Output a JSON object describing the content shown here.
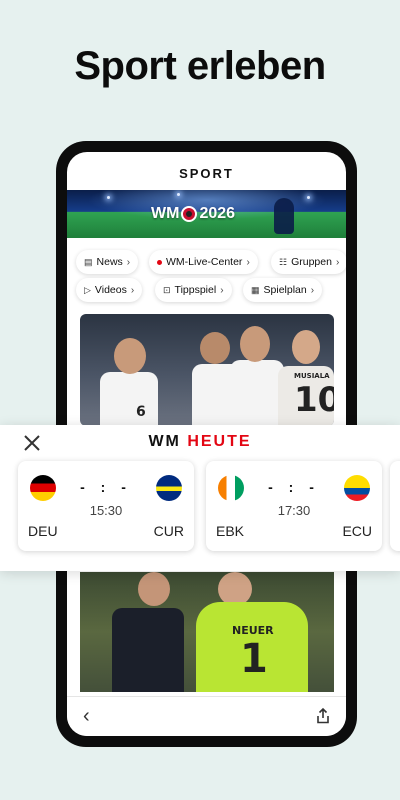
{
  "headline": "Sport erleben",
  "app": {
    "brand": "SPORT",
    "banner": {
      "wm": "WM",
      "year": "2026"
    },
    "chips_row1": [
      {
        "icon": "news-icon",
        "label": "News"
      },
      {
        "icon": "live-dot-icon",
        "label": "WM-Live-Center"
      },
      {
        "icon": "groups-icon",
        "label": "Gruppen"
      }
    ],
    "chips_row2": [
      {
        "icon": "play-icon",
        "label": "Videos"
      },
      {
        "icon": "tip-icon",
        "label": "Tippspiel"
      },
      {
        "icon": "calendar-icon",
        "label": "Spielplan"
      }
    ],
    "jersey_number": "10",
    "jersey_name": "MUSIALA",
    "jersey_number_2": "6",
    "keeper_name": "NEUER",
    "keeper_number": "1"
  },
  "panel": {
    "title_part1": "WM",
    "title_part2": "HEUTE",
    "matches": [
      {
        "home": "DEU",
        "away": "CUR",
        "score": "- : -",
        "time": "15:30"
      },
      {
        "home": "EBK",
        "away": "ECU",
        "score": "- : -",
        "time": "17:30"
      }
    ]
  },
  "colors": {
    "accent": "#e30613",
    "background": "#e6f1ef"
  }
}
